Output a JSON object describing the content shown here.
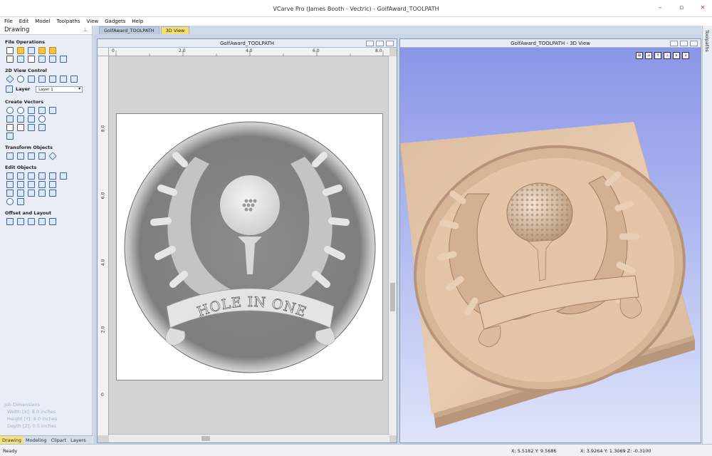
{
  "window": {
    "title": "VCarve Pro (James Booth - Vectric) - GolfAward_TOOLPATH",
    "controls": [
      "–",
      "▫",
      "×"
    ]
  },
  "menu": [
    "File",
    "Edit",
    "Model",
    "Toolpaths",
    "View",
    "Gadgets",
    "Help"
  ],
  "left_panel": {
    "title": "Drawing",
    "pin": "⊥",
    "sections": {
      "file_operations": "File Operations",
      "view_control": "2D View Control",
      "create_vectors": "Create Vectors",
      "transform_objects": "Transform Objects",
      "edit_objects": "Edit Objects",
      "offset_layout": "Offset and Layout"
    },
    "layer_label": "Layer",
    "layer_value": "Layer 1",
    "job_dimensions": {
      "title": "Job Dimensions",
      "width": "Width  [X]: 8.0 inches",
      "height": "Height [Y]: 8.0 inches",
      "depth": "Depth  [Z]: 0.5 inches"
    },
    "bottom_tabs": [
      "Drawing",
      "Modeling",
      "Clipart",
      "Layers"
    ]
  },
  "doc_tabs": [
    "GolfAward_TOOLPATH",
    "3D View"
  ],
  "view2d": {
    "title": "GolfAward_TOOLPATH",
    "ruler_h": [
      "0",
      "2.0",
      "4.0",
      "6.0",
      "8.0"
    ],
    "ruler_v": [
      "8.0",
      "6.0",
      "4.0",
      "2.0",
      "0"
    ],
    "banner_text": "HOLE IN ONE"
  },
  "view3d": {
    "title": "GolfAward_TOOLPATH - 3D View",
    "toolbar_icons": [
      "fit-icon",
      "iso-icon",
      "top-icon",
      "left-icon",
      "front-icon",
      "right-icon"
    ]
  },
  "right_panel": {
    "label": "Toolpaths"
  },
  "status": {
    "ready": "Ready",
    "coords_2d": "X: 5.5182 Y: 9.5686",
    "coords_3d": "X: 3.9264 Y: 1.3069 Z: -0.3100"
  },
  "colors": {
    "wood": "#e2c3a6",
    "sky_top": "#8a96e8",
    "tab_active": "#f7df6e"
  }
}
